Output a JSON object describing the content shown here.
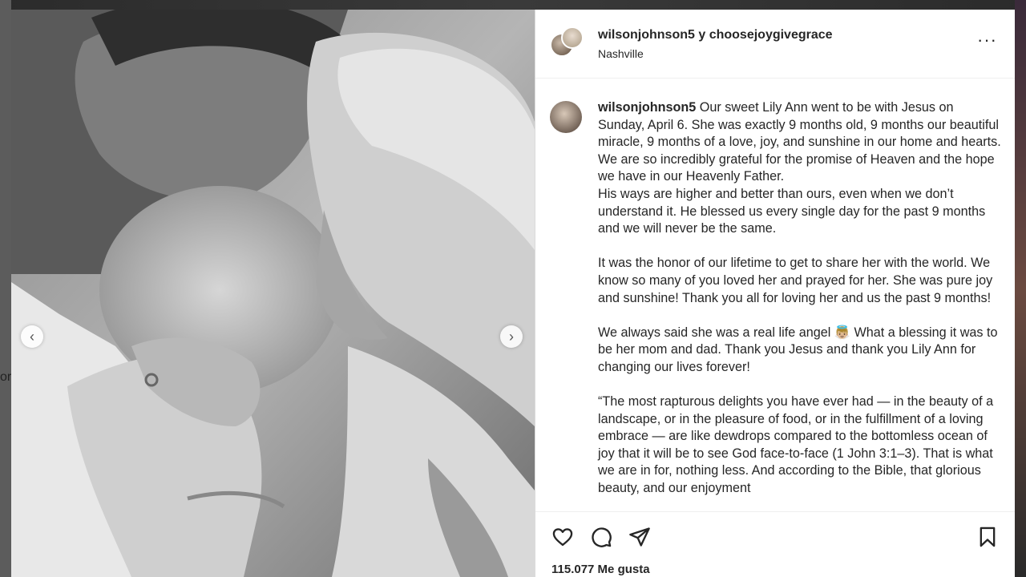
{
  "backdrop": {
    "left_text": "or"
  },
  "post": {
    "header": {
      "author": "wilsonjohnson5",
      "joiner": "y",
      "coauthor": "choosejoygivegrace",
      "location": "Nashville",
      "more_icon": "more-horizontal-icon"
    },
    "media": {
      "prev_icon": "chevron-left-icon",
      "next_icon": "chevron-right-icon",
      "prev_glyph": "‹",
      "next_glyph": "›"
    },
    "caption": {
      "username": "wilsonjohnson5",
      "paragraphs": [
        " Our sweet Lily Ann went to be with Jesus on Sunday, April 6. She was exactly 9 months old, 9 months our beautiful miracle, 9 months of a love, joy, and sunshine in our home and hearts. We are so incredibly grateful for the promise of Heaven and the hope we have in our Heavenly Father.",
        "His ways are higher and better than ours, even when we don’t understand it. He blessed us every single day for the past 9 months and we will never be the same.",
        "It was the honor of our lifetime to get to share her with the world. We know so many of you loved her and prayed for her. She was pure joy and sunshine! Thank you all for loving her and us the past 9 months!",
        "We always said she was a real life angel 👼🏼 What a blessing it was to be her mom and dad. Thank you Jesus and thank you Lily Ann for changing our lives forever!",
        "“The most rapturous delights you have ever had — in the beauty of a landscape, or in the pleasure of food, or in the fulfillment of a loving embrace — are like dewdrops compared to the bottomless ocean of joy that it will be to see God face-to-face (1 John 3:1–3). That is what we are in for, nothing less. And according to the Bible, that glorious beauty, and our enjoyment"
      ]
    },
    "actions": {
      "like_icon": "heart-icon",
      "comment_icon": "comment-icon",
      "share_icon": "send-icon",
      "save_icon": "bookmark-icon",
      "likes_text": "115.077 Me gusta"
    }
  }
}
